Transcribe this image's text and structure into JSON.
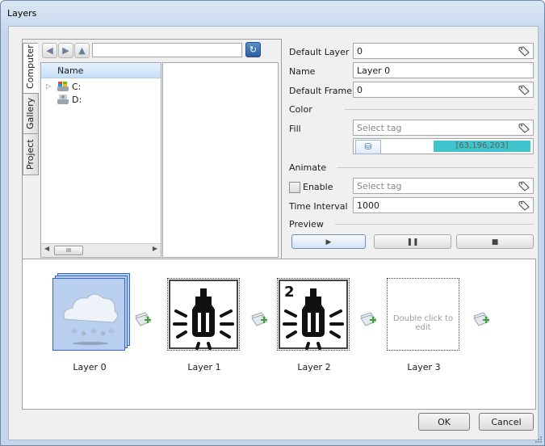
{
  "window": {
    "title": "Layers"
  },
  "browser": {
    "tabs": [
      "Computer",
      "Gallery",
      "Project"
    ],
    "path_value": "",
    "tree_header": "Name",
    "drives": [
      {
        "label": "C:",
        "icon": "drive-windows-icon"
      },
      {
        "label": "D:",
        "icon": "drive-icon"
      }
    ],
    "scroll_thumb": "III"
  },
  "properties": {
    "default_layer_label": "Default Layer",
    "default_layer_value": "0",
    "name_label": "Name",
    "name_value": "Layer 0",
    "default_frame_label": "Default Frame",
    "default_frame_value": "0",
    "color_section": "Color",
    "fill_label": "Fill",
    "fill_placeholder": "Select tag",
    "fill_color_text": "[63,196,203]",
    "fill_color": "#3fc4cb",
    "animate_section": "Animate",
    "enable_label": "Enable",
    "enable_checked": false,
    "enable_placeholder": "Select tag",
    "time_interval_label": "Time Interval",
    "time_interval_value": "1000",
    "preview_section": "Preview"
  },
  "layers": [
    {
      "label": "Layer 0",
      "selected": true,
      "image": "weather-snow-cloud"
    },
    {
      "label": "Layer 1",
      "selected": false,
      "image": "lamp-light"
    },
    {
      "label": "Layer 2",
      "selected": false,
      "image": "lamp-light-2",
      "badge": "2"
    },
    {
      "label": "Layer 3",
      "selected": false,
      "image": "empty",
      "placeholder": "Double click to edit"
    }
  ],
  "buttons": {
    "ok": "OK",
    "cancel": "Cancel"
  },
  "colors": {
    "selection": "#b8cff0",
    "accent": "#3864c7"
  }
}
